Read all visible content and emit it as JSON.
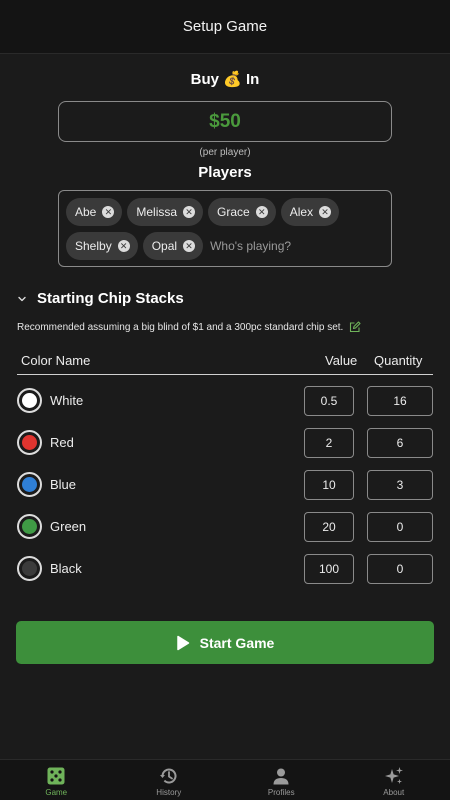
{
  "header": {
    "title": "Setup Game"
  },
  "buy_in": {
    "title_pre": "Buy",
    "title_emoji": "💰",
    "title_post": "In",
    "value": "$50",
    "note": "(per player)"
  },
  "players": {
    "title": "Players",
    "list": [
      "Abe",
      "Melissa",
      "Grace",
      "Alex",
      "Shelby",
      "Opal"
    ],
    "input_placeholder": "Who's playing?",
    "input_value": ""
  },
  "chip_stacks": {
    "title": "Starting Chip Stacks",
    "recommendation": "Recommended assuming a big blind of $1 and a 300pc standard chip set.",
    "columns": {
      "name": "Color Name",
      "value": "Value",
      "quantity": "Quantity"
    },
    "rows": [
      {
        "name": "White",
        "color": "#ffffff",
        "value": "0.5",
        "quantity": "16"
      },
      {
        "name": "Red",
        "color": "#e0342f",
        "value": "2",
        "quantity": "6"
      },
      {
        "name": "Blue",
        "color": "#2f7fd6",
        "value": "10",
        "quantity": "3"
      },
      {
        "name": "Green",
        "color": "#3f9a45",
        "value": "20",
        "quantity": "0"
      },
      {
        "name": "Black",
        "color": "#3b3b3b",
        "value": "100",
        "quantity": "0"
      }
    ]
  },
  "start_button": {
    "label": "Start Game",
    "color": "#3d8f3b"
  },
  "nav": {
    "items": [
      {
        "label": "Game",
        "icon": "dice-icon",
        "active": true
      },
      {
        "label": "History",
        "icon": "history-icon",
        "active": false
      },
      {
        "label": "Profiles",
        "icon": "person-icon",
        "active": false
      },
      {
        "label": "About",
        "icon": "sparkles-icon",
        "active": false
      }
    ]
  },
  "colors": {
    "accent": "#6fb35a",
    "background": "#1b1b1b",
    "buyin_text": "#4a9a3c"
  }
}
